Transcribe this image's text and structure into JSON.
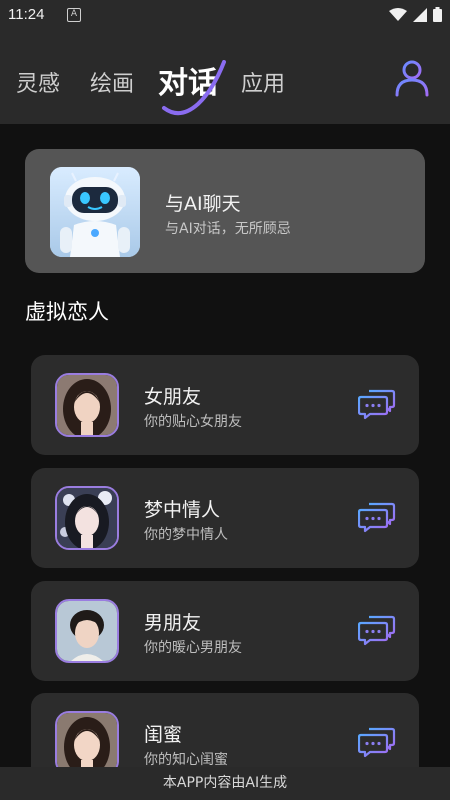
{
  "status_bar": {
    "time": "11:24",
    "notification_letter": "A"
  },
  "header": {
    "tabs": [
      {
        "label": "灵感"
      },
      {
        "label": "绘画"
      },
      {
        "label": "对话"
      },
      {
        "label": "应用"
      }
    ],
    "active_tab": "对话",
    "accent_color": "#8a6cf0"
  },
  "ai_chat": {
    "title": "与AI聊天",
    "subtitle": "与AI对话，无所顾忌"
  },
  "section": {
    "title": "虚拟恋人"
  },
  "lovers": [
    {
      "name": "女朋友",
      "desc": "你的贴心女朋友"
    },
    {
      "name": "梦中情人",
      "desc": "你的梦中情人"
    },
    {
      "name": "男朋友",
      "desc": "你的暖心男朋友"
    },
    {
      "name": "闺蜜",
      "desc": "你的知心闺蜜"
    }
  ],
  "footer": {
    "text": "本APP内容由AI生成"
  }
}
